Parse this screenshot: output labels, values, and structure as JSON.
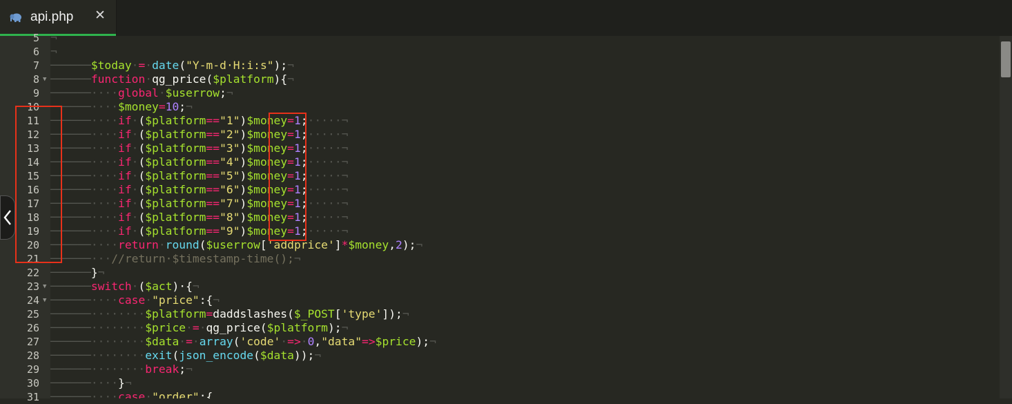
{
  "tab": {
    "filename": "api.php",
    "close_glyph": "✕",
    "icon": "elephant-icon"
  },
  "colors": {
    "keyword": "#f92672",
    "function": "#a6e22e",
    "builtin": "#66d9ef",
    "string": "#e6db74",
    "number": "#ae81ff",
    "comment": "#75715e",
    "highlight": "#e8311a"
  },
  "lines": [
    {
      "n": "5",
      "fold": false,
      "tokens": [
        [
          "ws",
          "¬"
        ]
      ]
    },
    {
      "n": "6",
      "fold": false,
      "tokens": [
        [
          "ws",
          "¬"
        ]
      ]
    },
    {
      "n": "7",
      "fold": false,
      "tokens": [
        [
          "ws",
          "──────"
        ],
        [
          "fn",
          "$today"
        ],
        [
          "ws",
          "·"
        ],
        [
          "op",
          "="
        ],
        [
          "ws",
          "·"
        ],
        [
          "bi",
          "date"
        ],
        [
          "pl",
          "("
        ],
        [
          "st",
          "\"Y-m-d·H:i:s\""
        ],
        [
          "pl",
          ");"
        ],
        [
          "ws",
          "¬"
        ]
      ]
    },
    {
      "n": "8",
      "fold": true,
      "tokens": [
        [
          "ws",
          "──────"
        ],
        [
          "kw",
          "function"
        ],
        [
          "ws",
          "·"
        ],
        [
          "pl",
          "qg_price("
        ],
        [
          "fn",
          "$platform"
        ],
        [
          "pl",
          "){"
        ],
        [
          "ws",
          "¬"
        ]
      ]
    },
    {
      "n": "9",
      "fold": false,
      "tokens": [
        [
          "ws",
          "──────····"
        ],
        [
          "kw",
          "global"
        ],
        [
          "ws",
          "·"
        ],
        [
          "fn",
          "$userrow"
        ],
        [
          "pl",
          ";"
        ],
        [
          "ws",
          "¬"
        ]
      ]
    },
    {
      "n": "10",
      "fold": false,
      "tokens": [
        [
          "ws",
          "──────····"
        ],
        [
          "fn",
          "$money"
        ],
        [
          "op",
          "="
        ],
        [
          "nu",
          "10"
        ],
        [
          "pl",
          ";"
        ],
        [
          "ws",
          "¬"
        ]
      ]
    },
    {
      "n": "11",
      "fold": false,
      "tokens": [
        [
          "ws",
          "──────····"
        ],
        [
          "kw",
          "if"
        ],
        [
          "ws",
          "·"
        ],
        [
          "pl",
          "("
        ],
        [
          "fn",
          "$platform"
        ],
        [
          "op",
          "=="
        ],
        [
          "st",
          "\"1\""
        ],
        [
          "pl",
          ")"
        ],
        [
          "fn",
          "$money"
        ],
        [
          "op",
          "="
        ],
        [
          "nu",
          "1"
        ],
        [
          "pl",
          ";"
        ],
        [
          "ws",
          "·····¬"
        ]
      ]
    },
    {
      "n": "12",
      "fold": false,
      "tokens": [
        [
          "ws",
          "──────····"
        ],
        [
          "kw",
          "if"
        ],
        [
          "ws",
          "·"
        ],
        [
          "pl",
          "("
        ],
        [
          "fn",
          "$platform"
        ],
        [
          "op",
          "=="
        ],
        [
          "st",
          "\"2\""
        ],
        [
          "pl",
          ")"
        ],
        [
          "fn",
          "$money"
        ],
        [
          "op",
          "="
        ],
        [
          "nu",
          "1"
        ],
        [
          "pl",
          ";"
        ],
        [
          "ws",
          "·····¬"
        ]
      ]
    },
    {
      "n": "13",
      "fold": false,
      "tokens": [
        [
          "ws",
          "──────····"
        ],
        [
          "kw",
          "if"
        ],
        [
          "ws",
          "·"
        ],
        [
          "pl",
          "("
        ],
        [
          "fn",
          "$platform"
        ],
        [
          "op",
          "=="
        ],
        [
          "st",
          "\"3\""
        ],
        [
          "pl",
          ")"
        ],
        [
          "fn",
          "$money"
        ],
        [
          "op",
          "="
        ],
        [
          "nu",
          "1"
        ],
        [
          "pl",
          ";"
        ],
        [
          "ws",
          "·····¬"
        ]
      ]
    },
    {
      "n": "14",
      "fold": false,
      "tokens": [
        [
          "ws",
          "──────····"
        ],
        [
          "kw",
          "if"
        ],
        [
          "ws",
          "·"
        ],
        [
          "pl",
          "("
        ],
        [
          "fn",
          "$platform"
        ],
        [
          "op",
          "=="
        ],
        [
          "st",
          "\"4\""
        ],
        [
          "pl",
          ")"
        ],
        [
          "fn",
          "$money"
        ],
        [
          "op",
          "="
        ],
        [
          "nu",
          "1"
        ],
        [
          "pl",
          ";"
        ],
        [
          "ws",
          "·····¬"
        ]
      ]
    },
    {
      "n": "15",
      "fold": false,
      "tokens": [
        [
          "ws",
          "──────····"
        ],
        [
          "kw",
          "if"
        ],
        [
          "ws",
          "·"
        ],
        [
          "pl",
          "("
        ],
        [
          "fn",
          "$platform"
        ],
        [
          "op",
          "=="
        ],
        [
          "st",
          "\"5\""
        ],
        [
          "pl",
          ")"
        ],
        [
          "fn",
          "$money"
        ],
        [
          "op",
          "="
        ],
        [
          "nu",
          "1"
        ],
        [
          "pl",
          ";"
        ],
        [
          "ws",
          "·····¬"
        ]
      ]
    },
    {
      "n": "16",
      "fold": false,
      "tokens": [
        [
          "ws",
          "──────····"
        ],
        [
          "kw",
          "if"
        ],
        [
          "ws",
          "·"
        ],
        [
          "pl",
          "("
        ],
        [
          "fn",
          "$platform"
        ],
        [
          "op",
          "=="
        ],
        [
          "st",
          "\"6\""
        ],
        [
          "pl",
          ")"
        ],
        [
          "fn",
          "$money"
        ],
        [
          "op",
          "="
        ],
        [
          "nu",
          "1"
        ],
        [
          "pl",
          ";"
        ],
        [
          "ws",
          "·····¬"
        ]
      ]
    },
    {
      "n": "17",
      "fold": false,
      "tokens": [
        [
          "ws",
          "──────····"
        ],
        [
          "kw",
          "if"
        ],
        [
          "ws",
          "·"
        ],
        [
          "pl",
          "("
        ],
        [
          "fn",
          "$platform"
        ],
        [
          "op",
          "=="
        ],
        [
          "st",
          "\"7\""
        ],
        [
          "pl",
          ")"
        ],
        [
          "fn",
          "$money"
        ],
        [
          "op",
          "="
        ],
        [
          "nu",
          "1"
        ],
        [
          "pl",
          ";"
        ],
        [
          "ws",
          "·····¬"
        ]
      ]
    },
    {
      "n": "18",
      "fold": false,
      "tokens": [
        [
          "ws",
          "──────····"
        ],
        [
          "kw",
          "if"
        ],
        [
          "ws",
          "·"
        ],
        [
          "pl",
          "("
        ],
        [
          "fn",
          "$platform"
        ],
        [
          "op",
          "=="
        ],
        [
          "st",
          "\"8\""
        ],
        [
          "pl",
          ")"
        ],
        [
          "fn",
          "$money"
        ],
        [
          "op",
          "="
        ],
        [
          "nu",
          "1"
        ],
        [
          "pl",
          ";"
        ],
        [
          "ws",
          "·····¬"
        ]
      ]
    },
    {
      "n": "19",
      "fold": false,
      "tokens": [
        [
          "ws",
          "──────····"
        ],
        [
          "kw",
          "if"
        ],
        [
          "ws",
          "·"
        ],
        [
          "pl",
          "("
        ],
        [
          "fn",
          "$platform"
        ],
        [
          "op",
          "=="
        ],
        [
          "st",
          "\"9\""
        ],
        [
          "pl",
          ")"
        ],
        [
          "fn",
          "$money"
        ],
        [
          "op",
          "="
        ],
        [
          "nu",
          "1"
        ],
        [
          "pl",
          ";"
        ],
        [
          "ws",
          "·····¬"
        ]
      ]
    },
    {
      "n": "20",
      "fold": false,
      "tokens": [
        [
          "ws",
          "──────····"
        ],
        [
          "kw",
          "return"
        ],
        [
          "ws",
          "·"
        ],
        [
          "bi",
          "round"
        ],
        [
          "pl",
          "("
        ],
        [
          "fn",
          "$userrow"
        ],
        [
          "pl",
          "["
        ],
        [
          "st",
          "'addprice'"
        ],
        [
          "pl",
          "]"
        ],
        [
          "op",
          "*"
        ],
        [
          "fn",
          "$money"
        ],
        [
          "pl",
          ","
        ],
        [
          "nu",
          "2"
        ],
        [
          "pl",
          ");"
        ],
        [
          "ws",
          "¬"
        ]
      ]
    },
    {
      "n": "21",
      "fold": false,
      "tokens": [
        [
          "ws",
          "──────···"
        ],
        [
          "cm",
          "//return·$timestamp-time();"
        ],
        [
          "ws",
          "¬"
        ]
      ]
    },
    {
      "n": "22",
      "fold": false,
      "tokens": [
        [
          "ws",
          "──────"
        ],
        [
          "pl",
          "}"
        ],
        [
          "ws",
          "¬"
        ]
      ]
    },
    {
      "n": "23",
      "fold": true,
      "tokens": [
        [
          "ws",
          "──────"
        ],
        [
          "kw",
          "switch"
        ],
        [
          "ws",
          "·"
        ],
        [
          "pl",
          "("
        ],
        [
          "fn",
          "$act"
        ],
        [
          "pl",
          ")·{"
        ],
        [
          "ws",
          "¬"
        ]
      ]
    },
    {
      "n": "24",
      "fold": true,
      "tokens": [
        [
          "ws",
          "──────····"
        ],
        [
          "kw",
          "case"
        ],
        [
          "ws",
          "·"
        ],
        [
          "st",
          "\"price\""
        ],
        [
          "pl",
          ":{"
        ],
        [
          "ws",
          "¬"
        ]
      ]
    },
    {
      "n": "25",
      "fold": false,
      "tokens": [
        [
          "ws",
          "──────········"
        ],
        [
          "fn",
          "$platform"
        ],
        [
          "op",
          "="
        ],
        [
          "pl",
          "daddslashes("
        ],
        [
          "fn",
          "$_POST"
        ],
        [
          "pl",
          "["
        ],
        [
          "st",
          "'type'"
        ],
        [
          "pl",
          "]);"
        ],
        [
          "ws",
          "¬"
        ]
      ]
    },
    {
      "n": "26",
      "fold": false,
      "tokens": [
        [
          "ws",
          "──────········"
        ],
        [
          "fn",
          "$price"
        ],
        [
          "ws",
          "·"
        ],
        [
          "op",
          "="
        ],
        [
          "ws",
          "·"
        ],
        [
          "pl",
          "qg_price("
        ],
        [
          "fn",
          "$platform"
        ],
        [
          "pl",
          ");"
        ],
        [
          "ws",
          "¬"
        ]
      ]
    },
    {
      "n": "27",
      "fold": false,
      "tokens": [
        [
          "ws",
          "──────········"
        ],
        [
          "fn",
          "$data"
        ],
        [
          "ws",
          "·"
        ],
        [
          "op",
          "="
        ],
        [
          "ws",
          "·"
        ],
        [
          "bi",
          "array"
        ],
        [
          "pl",
          "("
        ],
        [
          "st",
          "'code'"
        ],
        [
          "ws",
          "·"
        ],
        [
          "op",
          "=>"
        ],
        [
          "ws",
          "·"
        ],
        [
          "nu",
          "0"
        ],
        [
          "pl",
          ","
        ],
        [
          "st",
          "\"data\""
        ],
        [
          "op",
          "=>"
        ],
        [
          "fn",
          "$price"
        ],
        [
          "pl",
          ");"
        ],
        [
          "ws",
          "¬"
        ]
      ]
    },
    {
      "n": "28",
      "fold": false,
      "tokens": [
        [
          "ws",
          "──────········"
        ],
        [
          "bi",
          "exit"
        ],
        [
          "pl",
          "("
        ],
        [
          "bi",
          "json_encode"
        ],
        [
          "pl",
          "("
        ],
        [
          "fn",
          "$data"
        ],
        [
          "pl",
          "));"
        ],
        [
          "ws",
          "¬"
        ]
      ]
    },
    {
      "n": "29",
      "fold": false,
      "tokens": [
        [
          "ws",
          "──────········"
        ],
        [
          "kw",
          "break"
        ],
        [
          "pl",
          ";"
        ],
        [
          "ws",
          "¬"
        ]
      ]
    },
    {
      "n": "30",
      "fold": false,
      "tokens": [
        [
          "ws",
          "──────····"
        ],
        [
          "pl",
          "}"
        ],
        [
          "ws",
          "¬"
        ]
      ]
    },
    {
      "n": "31",
      "fold": false,
      "tokens": [
        [
          "ws",
          "──────····"
        ],
        [
          "kw",
          "case"
        ],
        [
          "ws",
          "·"
        ],
        [
          "st",
          "\"order\""
        ],
        [
          "pl",
          ":{"
        ]
      ]
    }
  ]
}
